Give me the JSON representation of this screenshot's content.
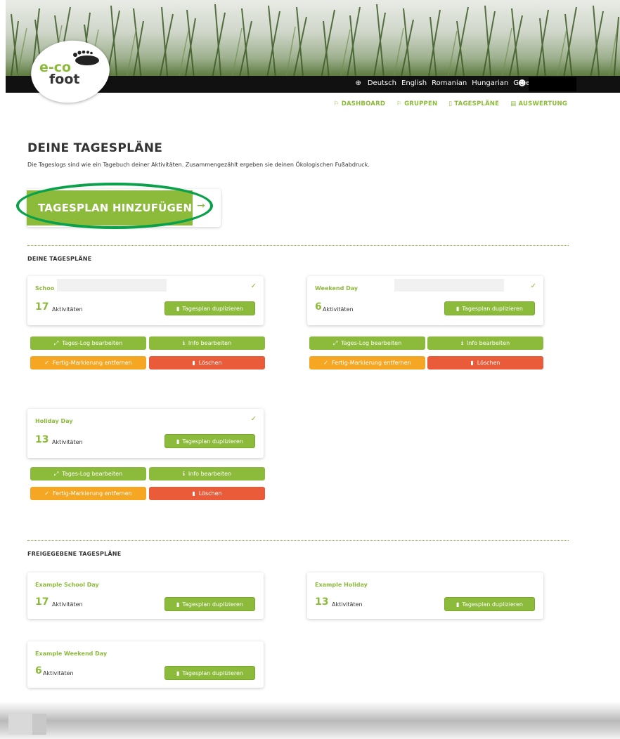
{
  "header": {
    "logo_eco": "e-co",
    "logo_foot": "foot",
    "languages": [
      "Deutsch",
      "English",
      "Romanian",
      "Hungarian",
      "Greek"
    ]
  },
  "nav": {
    "items": [
      "DASHBOARD",
      "GRUPPEN",
      "TAGESPLÄNE",
      "AUSWERTUNG"
    ]
  },
  "page": {
    "title": "DEINE TAGESPLÄNE",
    "subtitle": "Die Tageslogs sind wie ein Tagebuch deiner Aktivitäten. Zusammengezählt ergeben sie deinen Ökologischen Fußabdruck.",
    "add_button": "TAGESPLAN HINZUFÜGEN"
  },
  "own_section": {
    "title": "DEINE TAGESPLÄNE",
    "cards": [
      {
        "name": "Schoo",
        "count": "17",
        "count_label": "Aktivitäten",
        "duplicate": "Tagesplan duplizieren"
      },
      {
        "name": "Weekend Day",
        "count": "6",
        "count_label": "Aktivitäten",
        "duplicate": "Tagesplan duplizieren"
      },
      {
        "name": "Holiday Day",
        "count": "13",
        "count_label": "Aktivitäten",
        "duplicate": "Tagesplan duplizieren"
      }
    ],
    "actions": {
      "edit_log": "Tages-Log bearbeiten",
      "edit_info": "Info bearbeiten",
      "unmark": "Fertig-Markierung entfernen",
      "delete": "Löschen"
    }
  },
  "shared_section": {
    "title": "FREIGEGEBENE TAGESPLÄNE",
    "cards": [
      {
        "name": "Example School Day",
        "count": "17",
        "count_label": "Aktivitäten",
        "duplicate": "Tagesplan duplizieren"
      },
      {
        "name": "Example Holiday",
        "count": "13",
        "count_label": "Aktivitäten",
        "duplicate": "Tagesplan duplizieren"
      },
      {
        "name": "Example Weekend Day",
        "count": "6",
        "count_label": "Aktivitäten",
        "duplicate": "Tagesplan duplizieren"
      }
    ]
  },
  "colors": {
    "brand_green": "#8cba3a",
    "warning_orange": "#f5a623",
    "danger_red": "#ea5b3a",
    "highlight_green": "#0aa14a"
  },
  "icons": {
    "globe": "globe-icon",
    "user": "user-icon",
    "check": "check-icon",
    "copy": "copy-icon",
    "expand": "expand-icon",
    "info": "info-icon",
    "trash": "trash-icon",
    "arrow": "arrow-right-icon"
  }
}
